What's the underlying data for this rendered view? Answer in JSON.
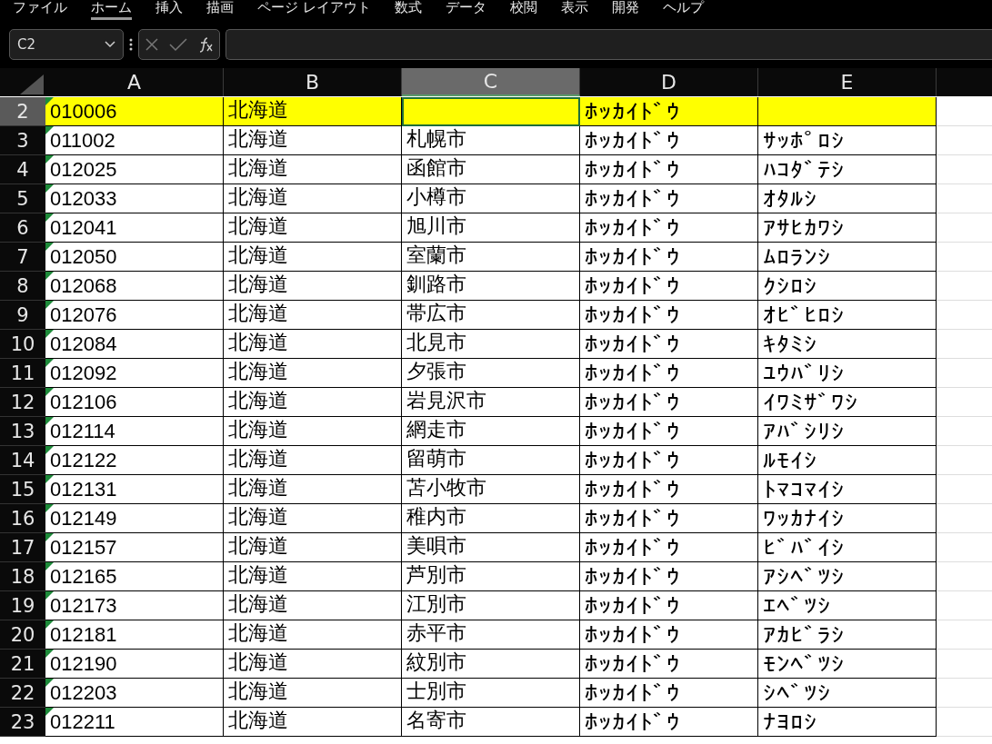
{
  "menu": [
    {
      "label": "ファイル",
      "selected": false
    },
    {
      "label": "ホーム",
      "selected": true
    },
    {
      "label": "挿入",
      "selected": false
    },
    {
      "label": "描画",
      "selected": false
    },
    {
      "label": "ページ レイアウト",
      "selected": false
    },
    {
      "label": "数式",
      "selected": false
    },
    {
      "label": "データ",
      "selected": false
    },
    {
      "label": "校閲",
      "selected": false
    },
    {
      "label": "表示",
      "selected": false
    },
    {
      "label": "開発",
      "selected": false
    },
    {
      "label": "ヘルプ",
      "selected": false
    }
  ],
  "formula_bar": {
    "name_box": "C2"
  },
  "columns": [
    {
      "label": "A",
      "selected": false
    },
    {
      "label": "B",
      "selected": false
    },
    {
      "label": "C",
      "selected": true
    },
    {
      "label": "D",
      "selected": false
    },
    {
      "label": "E",
      "selected": false
    }
  ],
  "rows": [
    {
      "number": "2",
      "selected": true,
      "highlighted": true,
      "cells": [
        "010006",
        "北海道",
        null,
        "ﾎｯｶｲﾄﾞｳ",
        null
      ]
    },
    {
      "number": "3",
      "selected": false,
      "highlighted": false,
      "cells": [
        "011002",
        "北海道",
        "札幌市",
        "ﾎｯｶｲﾄﾞｳ",
        "ｻｯﾎﾟﾛｼ"
      ]
    },
    {
      "number": "4",
      "selected": false,
      "highlighted": false,
      "cells": [
        "012025",
        "北海道",
        "函館市",
        "ﾎｯｶｲﾄﾞｳ",
        "ﾊｺﾀﾞﾃｼ"
      ]
    },
    {
      "number": "5",
      "selected": false,
      "highlighted": false,
      "cells": [
        "012033",
        "北海道",
        "小樽市",
        "ﾎｯｶｲﾄﾞｳ",
        "ｵﾀﾙｼ"
      ]
    },
    {
      "number": "6",
      "selected": false,
      "highlighted": false,
      "cells": [
        "012041",
        "北海道",
        "旭川市",
        "ﾎｯｶｲﾄﾞｳ",
        "ｱｻﾋｶﾜｼ"
      ]
    },
    {
      "number": "7",
      "selected": false,
      "highlighted": false,
      "cells": [
        "012050",
        "北海道",
        "室蘭市",
        "ﾎｯｶｲﾄﾞｳ",
        "ﾑﾛﾗﾝｼ"
      ]
    },
    {
      "number": "8",
      "selected": false,
      "highlighted": false,
      "cells": [
        "012068",
        "北海道",
        "釧路市",
        "ﾎｯｶｲﾄﾞｳ",
        "ｸｼﾛｼ"
      ]
    },
    {
      "number": "9",
      "selected": false,
      "highlighted": false,
      "cells": [
        "012076",
        "北海道",
        "帯広市",
        "ﾎｯｶｲﾄﾞｳ",
        "ｵﾋﾞﾋﾛｼ"
      ]
    },
    {
      "number": "10",
      "selected": false,
      "highlighted": false,
      "cells": [
        "012084",
        "北海道",
        "北見市",
        "ﾎｯｶｲﾄﾞｳ",
        "ｷﾀﾐｼ"
      ]
    },
    {
      "number": "11",
      "selected": false,
      "highlighted": false,
      "cells": [
        "012092",
        "北海道",
        "夕張市",
        "ﾎｯｶｲﾄﾞｳ",
        "ﾕｳﾊﾞﾘｼ"
      ]
    },
    {
      "number": "12",
      "selected": false,
      "highlighted": false,
      "cells": [
        "012106",
        "北海道",
        "岩見沢市",
        "ﾎｯｶｲﾄﾞｳ",
        "ｲﾜﾐｻﾞﾜｼ"
      ]
    },
    {
      "number": "13",
      "selected": false,
      "highlighted": false,
      "cells": [
        "012114",
        "北海道",
        "網走市",
        "ﾎｯｶｲﾄﾞｳ",
        "ｱﾊﾞｼﾘｼ"
      ]
    },
    {
      "number": "14",
      "selected": false,
      "highlighted": false,
      "cells": [
        "012122",
        "北海道",
        "留萌市",
        "ﾎｯｶｲﾄﾞｳ",
        "ﾙﾓｲｼ"
      ]
    },
    {
      "number": "15",
      "selected": false,
      "highlighted": false,
      "cells": [
        "012131",
        "北海道",
        "苫小牧市",
        "ﾎｯｶｲﾄﾞｳ",
        "ﾄﾏｺﾏｲｼ"
      ]
    },
    {
      "number": "16",
      "selected": false,
      "highlighted": false,
      "cells": [
        "012149",
        "北海道",
        "稚内市",
        "ﾎｯｶｲﾄﾞｳ",
        "ﾜｯｶﾅｲｼ"
      ]
    },
    {
      "number": "17",
      "selected": false,
      "highlighted": false,
      "cells": [
        "012157",
        "北海道",
        "美唄市",
        "ﾎｯｶｲﾄﾞｳ",
        "ﾋﾞﾊﾞｲｼ"
      ]
    },
    {
      "number": "18",
      "selected": false,
      "highlighted": false,
      "cells": [
        "012165",
        "北海道",
        "芦別市",
        "ﾎｯｶｲﾄﾞｳ",
        "ｱｼﾍﾞﾂｼ"
      ]
    },
    {
      "number": "19",
      "selected": false,
      "highlighted": false,
      "cells": [
        "012173",
        "北海道",
        "江別市",
        "ﾎｯｶｲﾄﾞｳ",
        "ｴﾍﾞﾂｼ"
      ]
    },
    {
      "number": "20",
      "selected": false,
      "highlighted": false,
      "cells": [
        "012181",
        "北海道",
        "赤平市",
        "ﾎｯｶｲﾄﾞｳ",
        "ｱｶﾋﾞﾗｼ"
      ]
    },
    {
      "number": "21",
      "selected": false,
      "highlighted": false,
      "cells": [
        "012190",
        "北海道",
        "紋別市",
        "ﾎｯｶｲﾄﾞｳ",
        "ﾓﾝﾍﾞﾂｼ"
      ]
    },
    {
      "number": "22",
      "selected": false,
      "highlighted": false,
      "cells": [
        "012203",
        "北海道",
        "士別市",
        "ﾎｯｶｲﾄﾞｳ",
        "ｼﾍﾞﾂｼ"
      ]
    },
    {
      "number": "23",
      "selected": false,
      "highlighted": false,
      "cells": [
        "012211",
        "北海道",
        "名寄市",
        "ﾎｯｶｲﾄﾞｳ",
        "ﾅﾖﾛｼ"
      ]
    }
  ]
}
